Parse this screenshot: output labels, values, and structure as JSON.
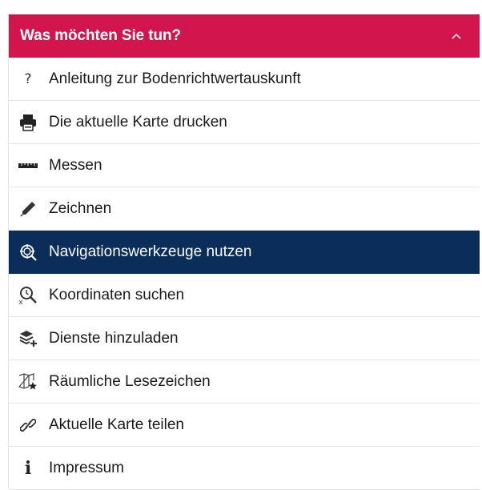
{
  "panel": {
    "title": "Was möchten Sie tun?",
    "header_color": "#d2164d",
    "active_color": "#0b2d5a"
  },
  "menu": {
    "items": [
      {
        "label": "Anleitung zur Bodenrichtwertauskunft",
        "icon": "help-icon",
        "glyph": "?"
      },
      {
        "label": "Die aktuelle Karte drucken",
        "icon": "print-icon"
      },
      {
        "label": "Messen",
        "icon": "ruler-icon"
      },
      {
        "label": "Zeichnen",
        "icon": "pencil-icon"
      },
      {
        "label": "Navigationswerkzeuge nutzen",
        "icon": "navigation-tools-icon",
        "active": true
      },
      {
        "label": "Koordinaten suchen",
        "icon": "coordinate-search-icon"
      },
      {
        "label": "Dienste hinzuladen",
        "icon": "add-layers-icon"
      },
      {
        "label": "Räumliche Lesezeichen",
        "icon": "spatial-bookmark-icon"
      },
      {
        "label": "Aktuelle Karte teilen",
        "icon": "share-link-icon"
      },
      {
        "label": "Impressum",
        "icon": "info-icon",
        "glyph": "i"
      }
    ]
  }
}
